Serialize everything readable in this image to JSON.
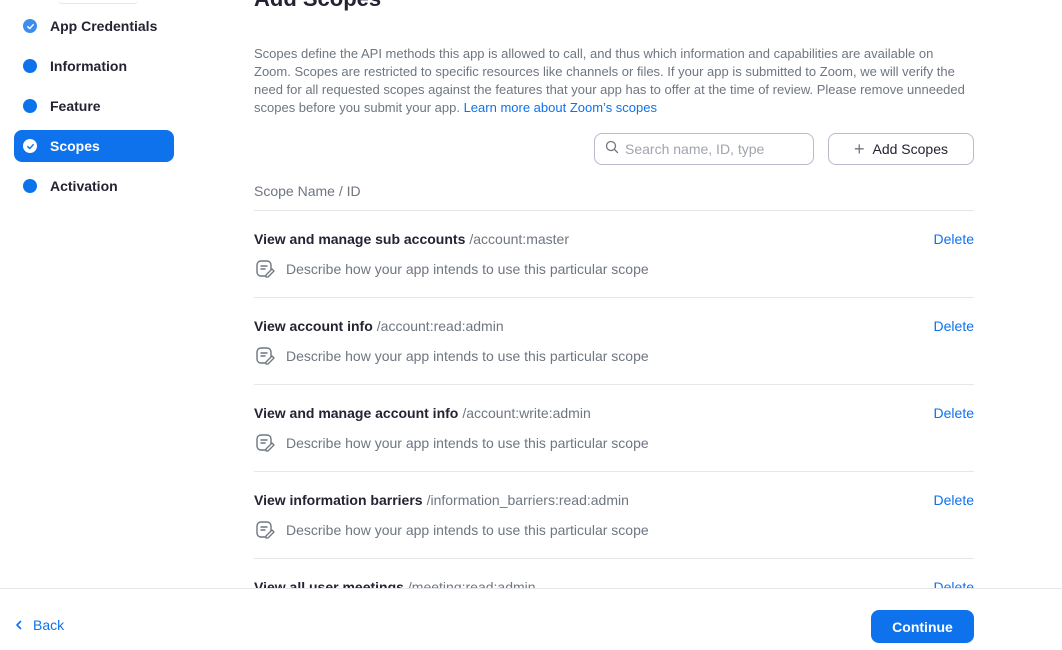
{
  "sidebar": {
    "items": [
      {
        "label": "App Credentials",
        "state": "completed"
      },
      {
        "label": "Information",
        "state": "pending"
      },
      {
        "label": "Feature",
        "state": "pending"
      },
      {
        "label": "Scopes",
        "state": "active"
      },
      {
        "label": "Activation",
        "state": "pending"
      }
    ]
  },
  "main": {
    "title": "Add Scopes",
    "intro_text": "Scopes define the API methods this app is allowed to call, and thus which information and capabilities are available on Zoom. Scopes are restricted to specific resources like channels or files. If your app is submitted to Zoom, we will verify the need for all requested scopes against the features that your app has to offer at the time of review. Please remove unneeded scopes before you submit your app.",
    "learn_more_link": "Learn more about Zoom’s scopes",
    "search": {
      "placeholder": "Search name, ID, type",
      "value": ""
    },
    "add_scopes_label": "Add Scopes",
    "column_header": "Scope Name / ID",
    "delete_label": "Delete",
    "description_placeholder": "Describe how your app intends to use this particular scope",
    "scopes": [
      {
        "name": "View and manage sub accounts",
        "id": "/account:master"
      },
      {
        "name": "View account info",
        "id": "/account:read:admin"
      },
      {
        "name": "View and manage account info",
        "id": "/account:write:admin"
      },
      {
        "name": "View information barriers",
        "id": "/information_barriers:read:admin"
      },
      {
        "name": "View all user meetings",
        "id": "/meeting:read:admin"
      }
    ]
  },
  "footer": {
    "back_label": "Back",
    "continue_label": "Continue"
  },
  "colors": {
    "accent": "#0e72ed",
    "text": "#232333",
    "muted": "#6e7680",
    "border": "#e6e6ea"
  }
}
